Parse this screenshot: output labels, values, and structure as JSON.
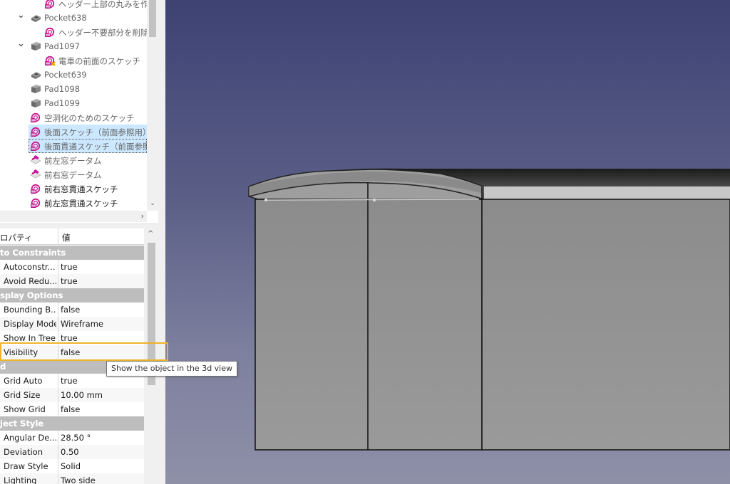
{
  "tree": {
    "items": [
      {
        "label": "ヘッダー上部の丸みを作成",
        "icon": "sketch-icon",
        "level": 2,
        "expanded": null,
        "grey": true
      },
      {
        "label": "Pocket638",
        "icon": "pocket-icon",
        "level": 1,
        "expanded": true,
        "grey": true
      },
      {
        "label": "ヘッダー不要部分を削除する",
        "icon": "sketch-icon",
        "level": 2,
        "expanded": null,
        "grey": true
      },
      {
        "label": "Pad1097",
        "icon": "pad-icon",
        "level": 1,
        "expanded": true,
        "grey": true
      },
      {
        "label": "電車の前面のスケッチ",
        "icon": "sketch-warning-icon",
        "level": 2,
        "expanded": null,
        "grey": true
      },
      {
        "label": "Pocket639",
        "icon": "pocket-icon",
        "level": 1,
        "expanded": null,
        "grey": true
      },
      {
        "label": "Pad1098",
        "icon": "pad-icon",
        "level": 1,
        "expanded": null,
        "grey": true
      },
      {
        "label": "Pad1099",
        "icon": "pad-icon",
        "level": 1,
        "expanded": null,
        "grey": true
      },
      {
        "label": "空洞化のためのスケッチ",
        "icon": "sketch-icon",
        "level": 1,
        "expanded": null,
        "grey": true
      },
      {
        "label": "後面スケッチ（前面参照用）",
        "icon": "sketch-icon",
        "level": 1,
        "expanded": null,
        "grey": true,
        "selected": true
      },
      {
        "label": "後面貫通スケッチ（前面参照）",
        "icon": "sketch-icon",
        "level": 1,
        "expanded": null,
        "grey": true,
        "selected": true,
        "current": true
      },
      {
        "label": "前左窓データム",
        "icon": "datum-icon",
        "level": 1,
        "expanded": null,
        "grey": true
      },
      {
        "label": "前右窓データム",
        "icon": "datum-icon",
        "level": 1,
        "expanded": null,
        "grey": true
      },
      {
        "label": "前右窓貫通スケッチ",
        "icon": "sketch-icon",
        "level": 1,
        "expanded": null,
        "grey": false
      },
      {
        "label": "前左窓貫通スケッチ",
        "icon": "sketch-icon",
        "level": 1,
        "expanded": null,
        "grey": false
      }
    ],
    "scroll_right_glyph": "›",
    "scroll_down_glyph": "⌄"
  },
  "properties": {
    "header": {
      "property": "ロパティ",
      "value": "値"
    },
    "scroll_up_glyph": "^",
    "rows": [
      {
        "group": "to Constraints"
      },
      {
        "name": "Autoconstr...",
        "value": "true"
      },
      {
        "name": "Avoid Redu...",
        "value": "true"
      },
      {
        "group": "splay Options"
      },
      {
        "name": "Bounding B...",
        "value": "false"
      },
      {
        "name": "Display Mode",
        "value": "Wireframe"
      },
      {
        "name": "Show In Tree",
        "value": "true"
      },
      {
        "name": "Visibility",
        "value": "false"
      },
      {
        "group": "d"
      },
      {
        "name": "Grid Auto",
        "value": "true"
      },
      {
        "name": "Grid Size",
        "value": "10.00 mm"
      },
      {
        "name": "Show Grid",
        "value": "false"
      },
      {
        "group": "ject Style"
      },
      {
        "name": "Angular De...",
        "value": "28.50 °"
      },
      {
        "name": "Deviation",
        "value": "0.50"
      },
      {
        "name": "Draw Style",
        "value": "Solid"
      },
      {
        "name": "Lighting",
        "value": "Two side"
      }
    ]
  },
  "tooltip": {
    "text": "Show the object in the 3d view"
  },
  "colors": {
    "highlight": "#f0b429",
    "selection": "#cce8ff",
    "group_header": "#bdbdbd",
    "view_top": "#3d4274",
    "view_bottom": "#8e90a8"
  }
}
